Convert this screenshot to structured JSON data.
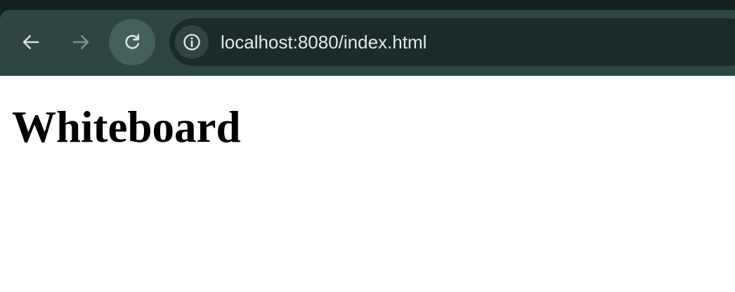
{
  "browser": {
    "toolbar": {
      "back_icon": "arrow-left-icon",
      "forward_icon": "arrow-right-icon",
      "reload_icon": "reload-icon",
      "info_icon": "info-icon"
    },
    "address_bar": {
      "url": "localhost:8080/index.html"
    }
  },
  "page": {
    "heading": "Whiteboard"
  },
  "colors": {
    "chrome_bg": "#12201f",
    "toolbar_bg": "#2f4541",
    "omnibox_bg": "#1a2c2a",
    "text_light": "#e3e9e8",
    "page_bg": "#ffffff",
    "heading_color": "#000000"
  }
}
